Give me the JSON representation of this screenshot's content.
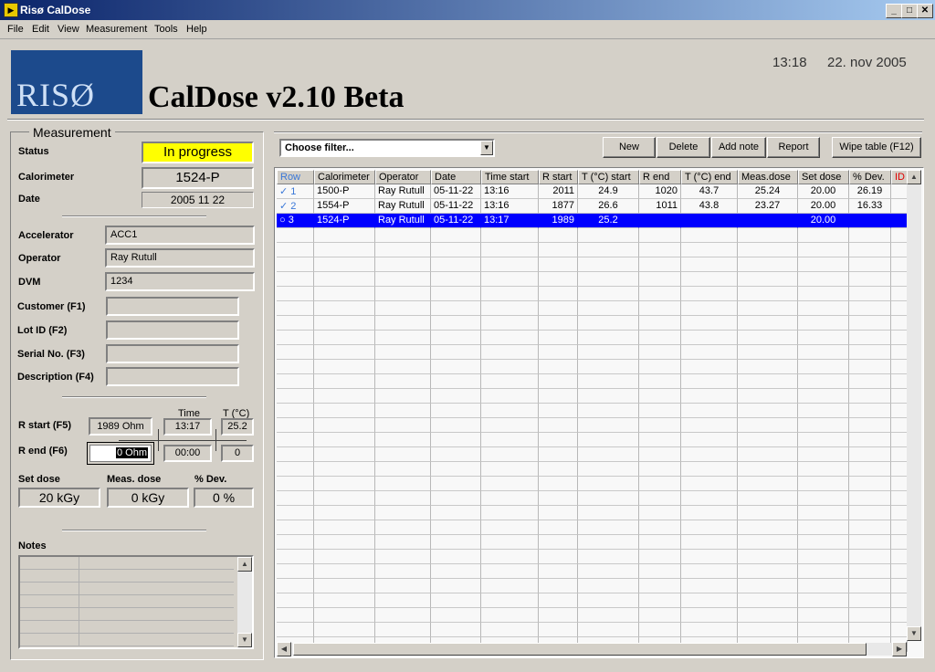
{
  "window": {
    "title": "Risø CalDose",
    "min": "_",
    "max": "□",
    "close": "✕"
  },
  "menu": [
    "File",
    "Edit",
    "View",
    "Measurement",
    "Tools",
    "Help"
  ],
  "header": {
    "logo": "RISØ",
    "app_title": "CalDose v2.10 Beta",
    "time": "13:18",
    "date": "22. nov 2005"
  },
  "measurement": {
    "panel_title": "Measurement",
    "status_label": "Status",
    "status_value": "In progress",
    "calorimeter_label": "Calorimeter",
    "calorimeter_value": "1524-P",
    "date_label": "Date",
    "date_value": "2005 11 22",
    "accelerator_label": "Accelerator",
    "accelerator_value": "ACC1",
    "operator_label": "Operator",
    "operator_value": "Ray Rutull",
    "dvm_label": "DVM",
    "dvm_value": "1234",
    "customer_label": "Customer (F1)",
    "customer_value": "",
    "lot_label": "Lot ID (F2)",
    "lot_value": "",
    "serial_label": "Serial No. (F3)",
    "serial_value": "",
    "description_label": "Description (F4)",
    "description_value": "",
    "time_header": "Time",
    "temp_header": "T (°C)",
    "rstart_label": "R start (F5)",
    "rstart_value": "1989 Ohm",
    "rstart_time": "13:17",
    "rstart_temp": "25.2",
    "rend_label": "R end (F6)",
    "rend_value": "0 Ohm",
    "rend_time": "00:00",
    "rend_temp": "0",
    "setdose_label": "Set dose",
    "setdose_value": "20 kGy",
    "measdose_label": "Meas. dose",
    "measdose_value": "0 kGy",
    "dev_label": "% Dev.",
    "dev_value": "0 %",
    "notes_label": "Notes"
  },
  "toolbar": {
    "filter_placeholder": "Choose filter...",
    "new": "New",
    "delete": "Delete",
    "add_note": "Add note",
    "report": "Report",
    "wipe": "Wipe table (F12)"
  },
  "table": {
    "headers": [
      "Row",
      "Calorimeter",
      "Operator",
      "Date",
      "Time start",
      "R start",
      "T (°C) start",
      "R end",
      "T (°C) end",
      "Meas.dose",
      "Set dose",
      "% Dev.",
      "ID"
    ],
    "rows": [
      [
        "✓ 1",
        "1500-P",
        "Ray Rutull",
        "05-11-22",
        "13:16",
        "2011",
        "24.9",
        "1020",
        "43.7",
        "25.24",
        "20.00",
        "26.19",
        ""
      ],
      [
        "✓ 2",
        "1554-P",
        "Ray Rutull",
        "05-11-22",
        "13:16",
        "1877",
        "26.6",
        "1011",
        "43.8",
        "23.27",
        "20.00",
        "16.33",
        ""
      ],
      [
        "○ 3",
        "1524-P",
        "Ray Rutull",
        "05-11-22",
        "13:17",
        "1989",
        "25.2",
        "",
        "",
        "",
        "20.00",
        "",
        ""
      ]
    ],
    "selected_row": 3
  },
  "colors": {
    "status_bg": "#ffff00",
    "selected_row": "#0000ff",
    "row_header_text": "#3a78d8",
    "id_header_text": "#e00000",
    "logo_bg": "#1c4a8c"
  }
}
